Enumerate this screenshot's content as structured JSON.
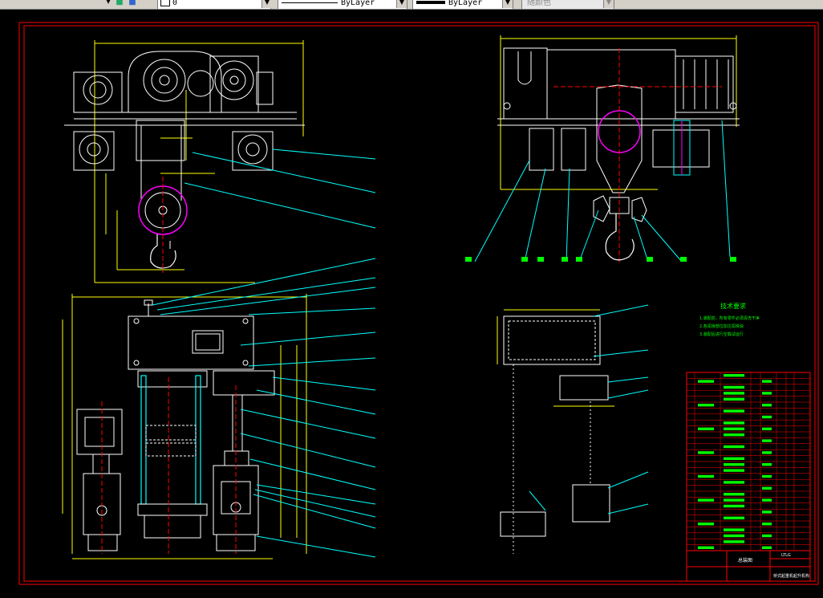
{
  "toolbar": {
    "layer_value": "0",
    "linetype_value": "ByLayer",
    "lineweight_value": "ByLayer",
    "color_value": "随颜色"
  },
  "drawing": {
    "tech_title": "技术要求",
    "tech_lines": [
      "1.装配前，所有零件必须清洗干净",
      "2.各润滑部位加注润滑油",
      "3.装配后进行空载试运行"
    ],
    "title_block": {
      "drawing_name": "总装图",
      "drawing_code": "LTLG",
      "project_name": "桥式起重机起升机构"
    },
    "colors": {
      "frame": "#ff0000",
      "yellow": "#ffff00",
      "cyan": "#00ffff",
      "white": "#ffffff",
      "magenta": "#ff00ff",
      "green": "#00ff00"
    }
  }
}
